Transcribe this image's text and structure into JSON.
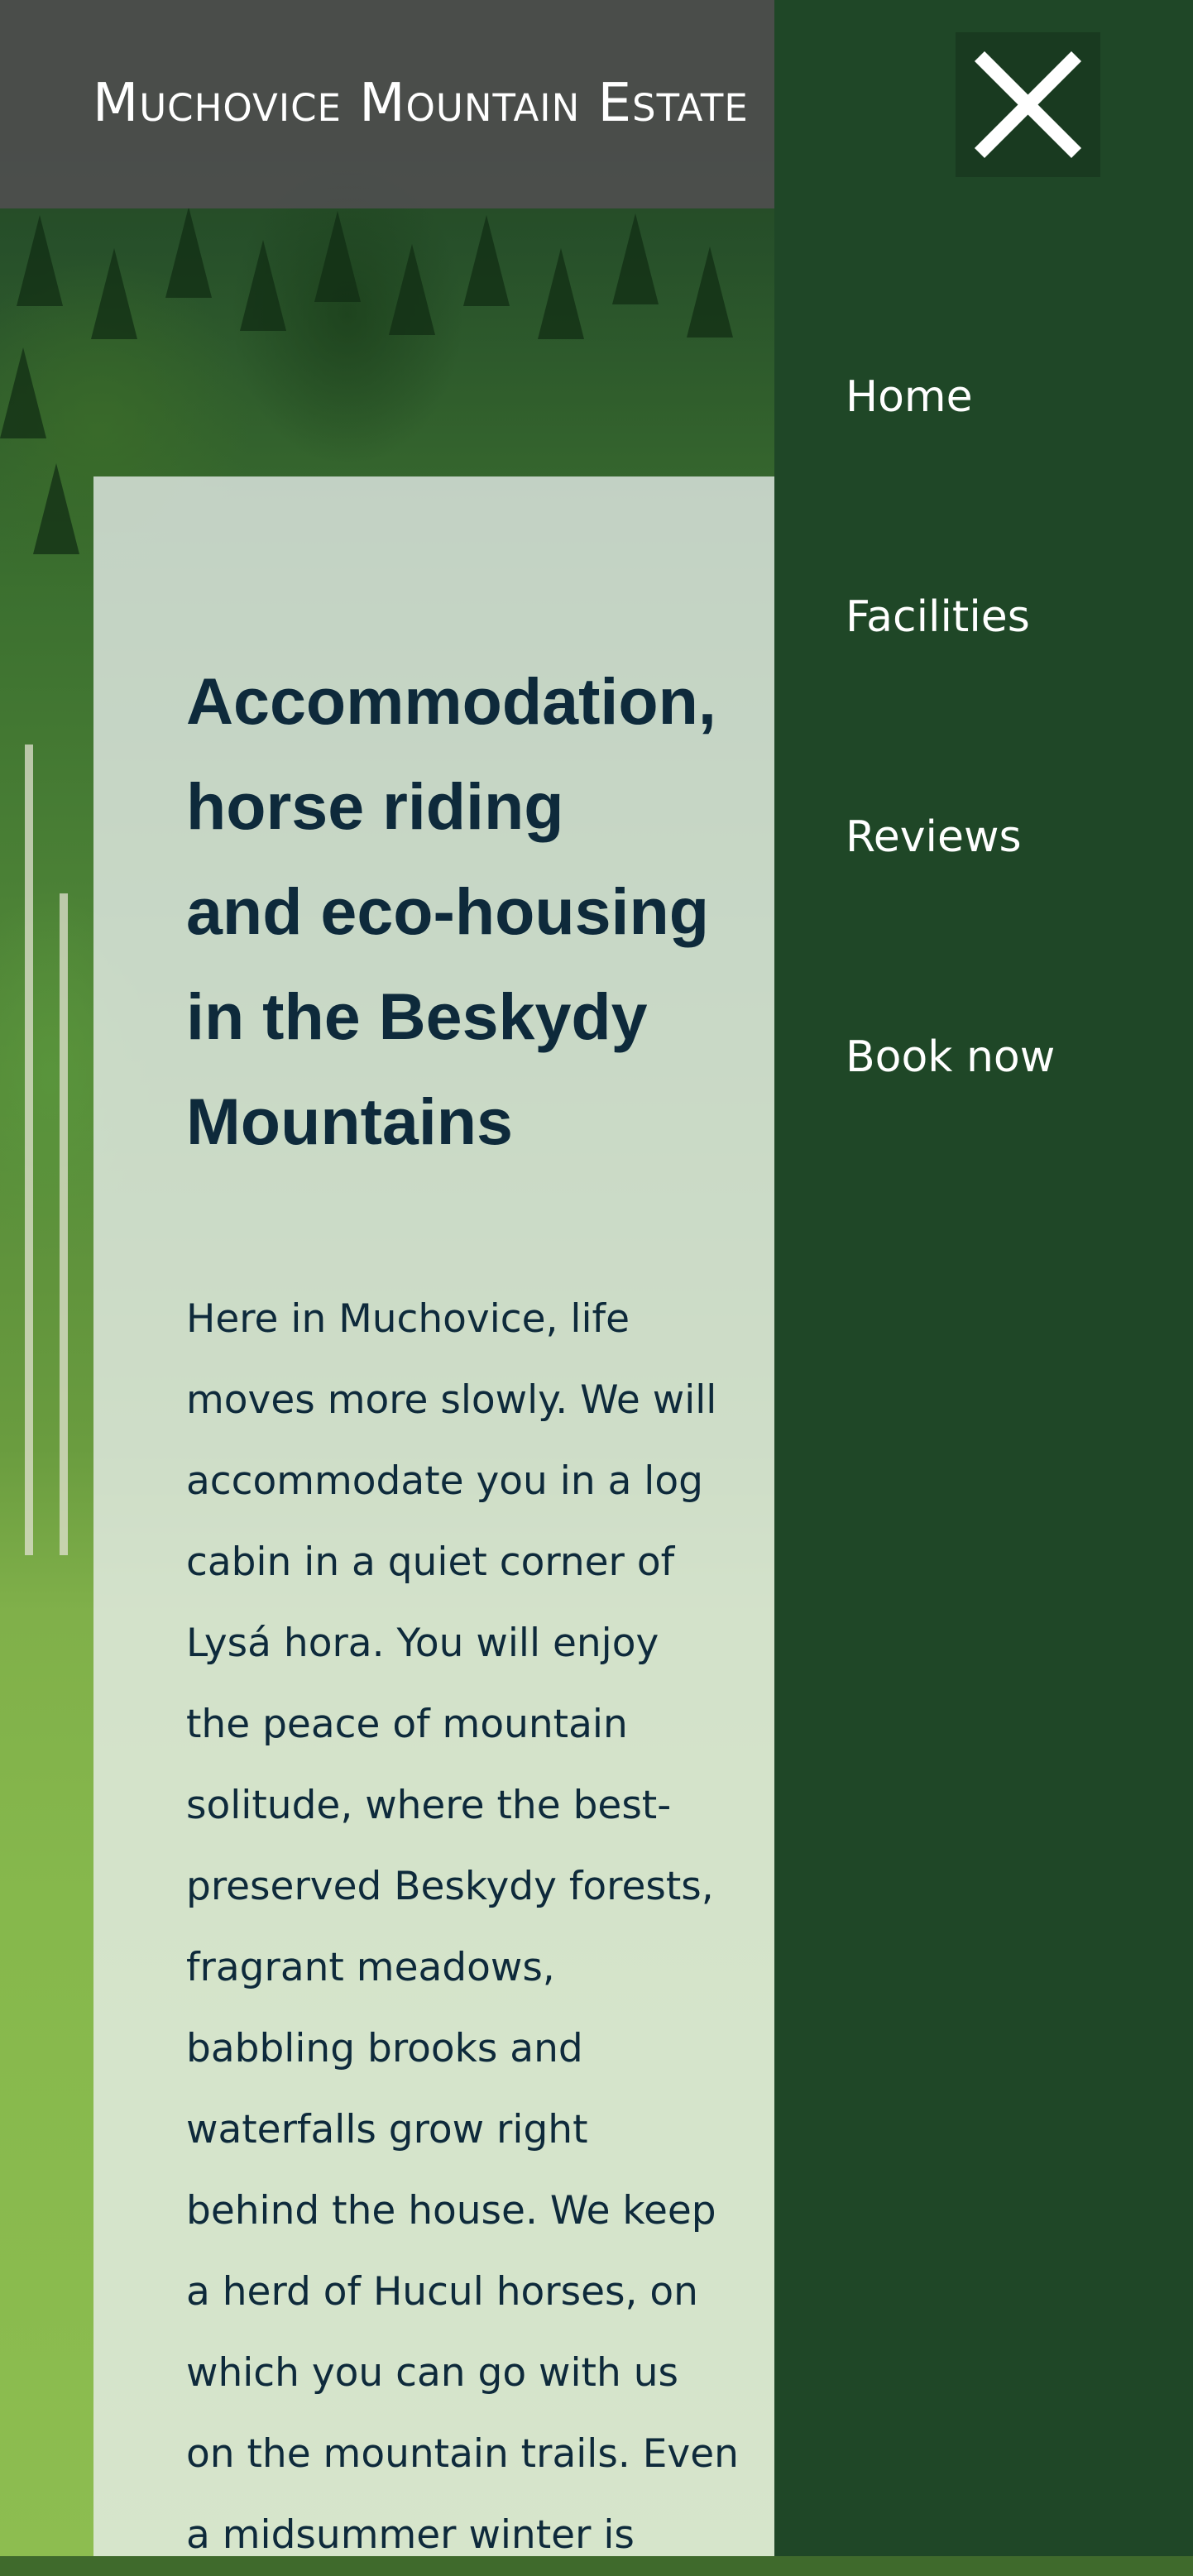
{
  "header": {
    "site_title": "Muchovice Mountain Estate"
  },
  "hero": {
    "heading_lines": [
      "Accommodation,",
      "horse riding",
      "and eco-housing",
      "in the Beskydy",
      "Mountains"
    ],
    "body_lines": [
      "Here in Muchovice, life",
      "moves more slowly. We will",
      "accommodate you in a log",
      "cabin in a quiet corner of",
      "Lysá hora. You will enjoy",
      "the peace of mountain",
      "solitude, where the best-",
      "preserved Beskydy forests,",
      "fragrant meadows,",
      "babbling brooks and",
      "waterfalls grow right",
      "behind the house. We keep",
      "a herd of Hucul horses, on",
      "which you can go with us",
      "on the mountain trails. Even",
      "a midsummer winter is"
    ]
  },
  "menu": {
    "close_icon": "close-icon",
    "items": [
      {
        "label": "Home"
      },
      {
        "label": "Facilities"
      },
      {
        "label": "Reviews"
      },
      {
        "label": "Book now"
      }
    ]
  },
  "colors": {
    "drawer_background": "#1f4727",
    "close_button_background": "#193a20",
    "header_background": "#4e4e4e",
    "heading_text": "#0e2a3b",
    "card_background": "#ebf0ee"
  }
}
